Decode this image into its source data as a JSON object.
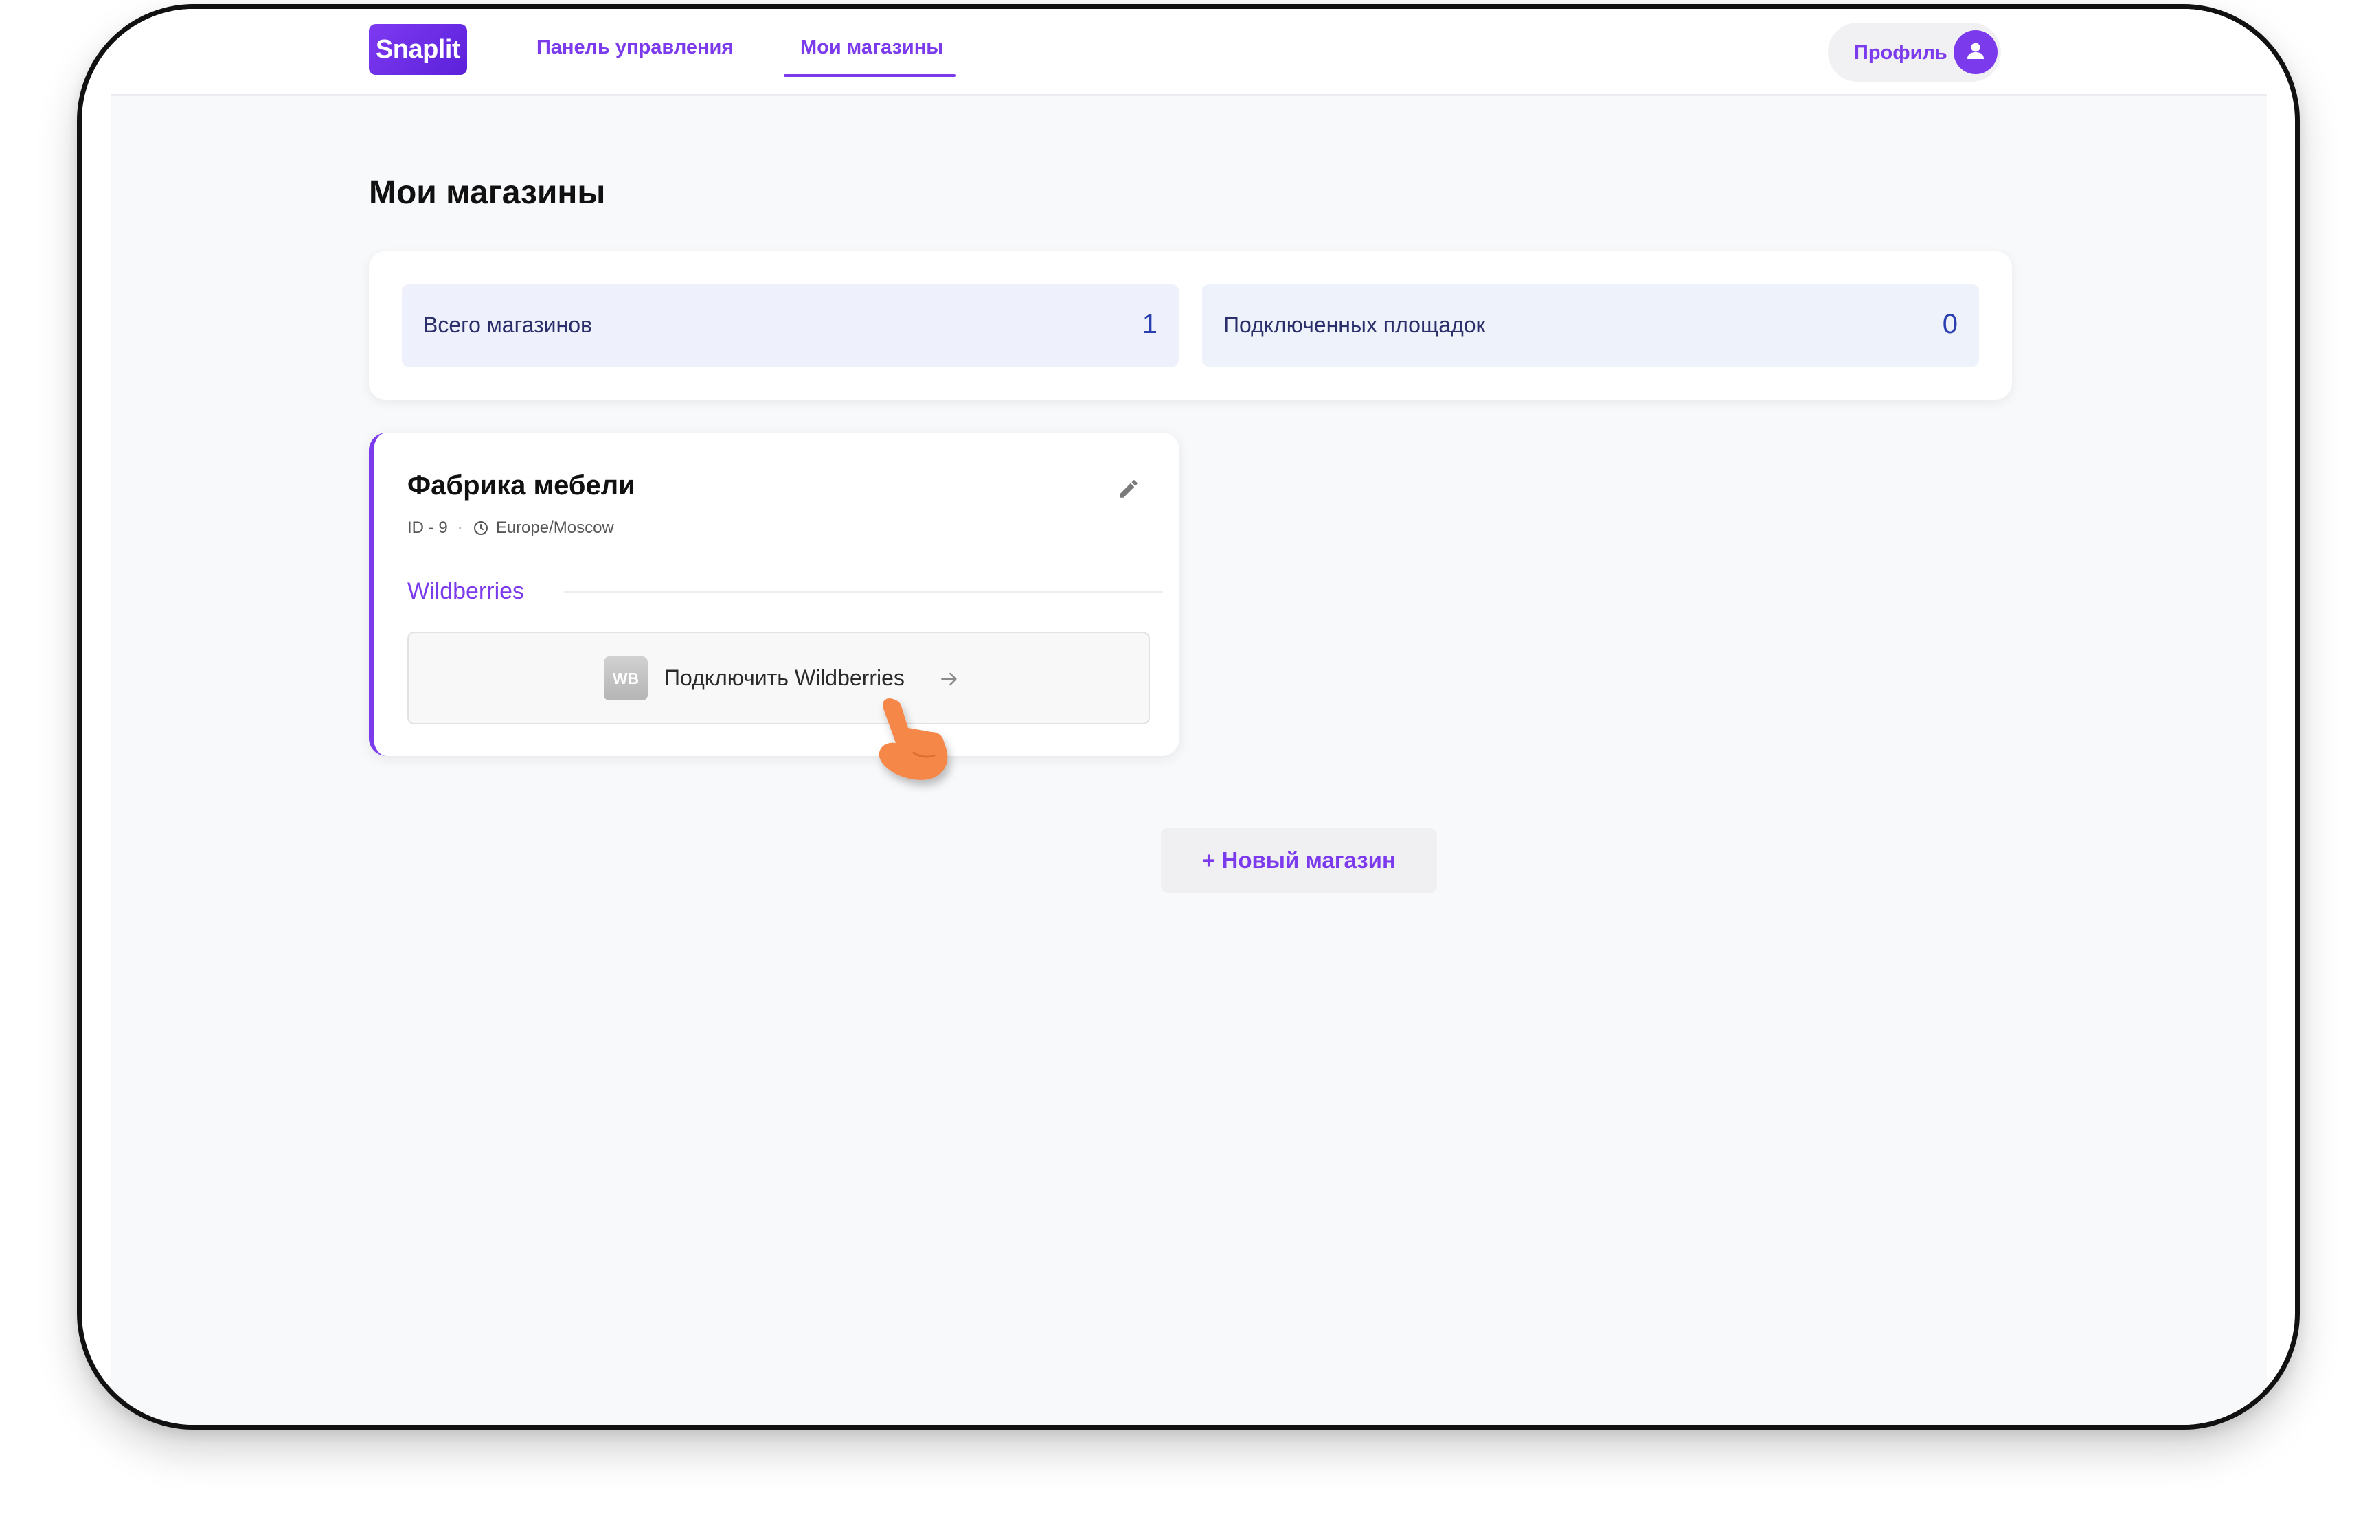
{
  "header": {
    "logo": "Snaplit",
    "nav": [
      {
        "label": "Панель управления",
        "active": false
      },
      {
        "label": "Мои магазины",
        "active": true
      }
    ],
    "profile_label": "Профиль",
    "profile_icon": "user-icon"
  },
  "page": {
    "title": "Мои магазины"
  },
  "stats": [
    {
      "label": "Всего магазинов",
      "value": "1"
    },
    {
      "label": "Подключенных площадок",
      "value": "0"
    }
  ],
  "shop": {
    "name": "Фабрика мебели",
    "id_text": "ID - 9",
    "timezone": "Europe/Moscow",
    "edit_icon": "pencil-icon",
    "marketplace": "Wildberries",
    "connect_badge": "WB",
    "connect_label": "Подключить Wildberries",
    "connect_icon": "arrow-right-icon"
  },
  "actions": {
    "new_shop_label": "+ Новый магазин"
  },
  "colors": {
    "accent": "#7c3aed",
    "stat_bg": "#eef0fb",
    "stat_text": "#2a2f6b",
    "stat_value": "#2a3fb0",
    "cursor": "#f5884a"
  }
}
